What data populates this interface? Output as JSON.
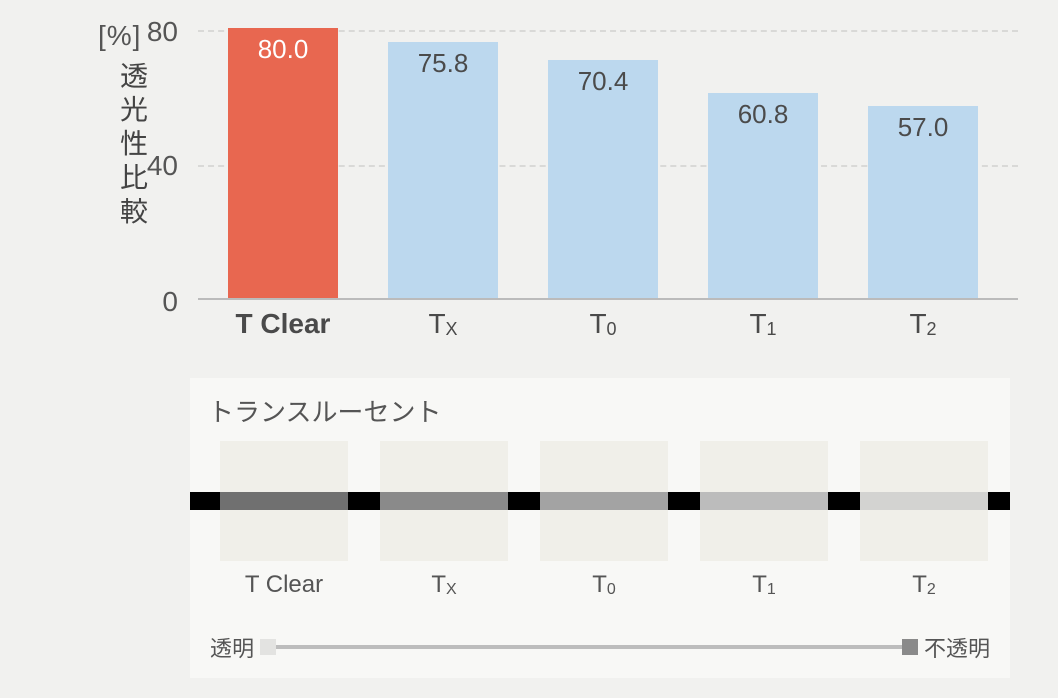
{
  "chart_data": {
    "type": "bar",
    "unit": "[%]",
    "ylabel": "透光性比較",
    "ylim": [
      0,
      80
    ],
    "yticks": [
      0,
      40,
      80
    ],
    "categories": [
      "T Clear",
      "Tx",
      "T0",
      "T1",
      "T2"
    ],
    "values": [
      80.0,
      75.8,
      70.4,
      60.8,
      57.0
    ],
    "highlight_index": 0,
    "category_labels": [
      {
        "main": "T Clear",
        "sub": "",
        "bold": true
      },
      {
        "main": "T",
        "sub": "X"
      },
      {
        "main": "T",
        "sub": "0"
      },
      {
        "main": "T",
        "sub": "1"
      },
      {
        "main": "T",
        "sub": "2"
      }
    ]
  },
  "translucent_panel": {
    "title": "トランスルーセント",
    "swatches": [
      {
        "label_main": "T Clear",
        "label_sub": "",
        "band_color": "#707070"
      },
      {
        "label_main": "T",
        "label_sub": "X",
        "band_color": "#8a8a8a"
      },
      {
        "label_main": "T",
        "label_sub": "0",
        "band_color": "#a3a3a3"
      },
      {
        "label_main": "T",
        "label_sub": "1",
        "band_color": "#bcbcbc"
      },
      {
        "label_main": "T",
        "label_sub": "2",
        "band_color": "#d3d3d1"
      }
    ],
    "legend_left": "透明",
    "legend_right": "不透明"
  }
}
